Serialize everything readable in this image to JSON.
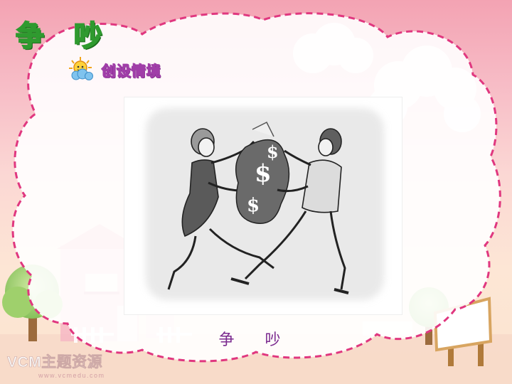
{
  "slide": {
    "title": "争 吵",
    "subtitle": "创设情境",
    "caption": "争 吵",
    "watermark_logo": "VCM主题资源",
    "watermark_url": "www.vcmedu.com"
  },
  "icons": {
    "subtitle_icon": "sun-cloud-icon",
    "photo_content": "money-tug-illustration"
  },
  "colors": {
    "title_fill": "#ffe44a",
    "title_stroke": "#2f9a2f",
    "subtitle_stroke": "#a03ea8",
    "caption": "#7b2a8f",
    "dashed_border": "#e0377f"
  }
}
